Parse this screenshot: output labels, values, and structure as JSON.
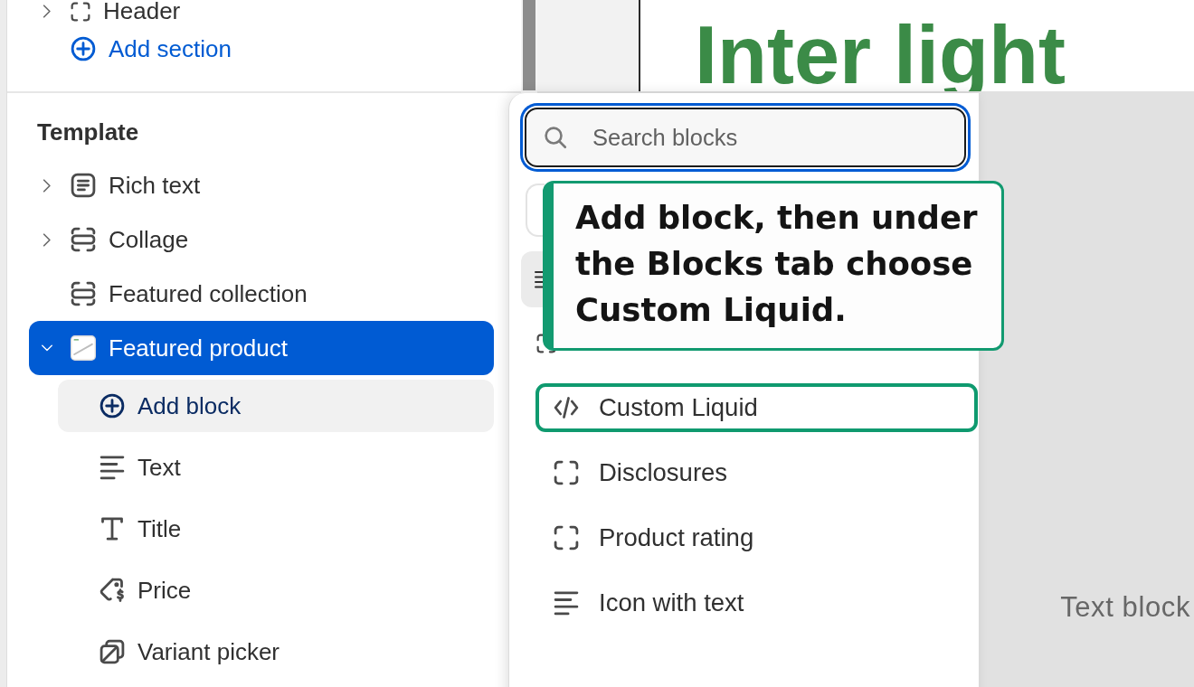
{
  "sidebar": {
    "header_row": {
      "label": "Header",
      "kind": "group",
      "expanded": false
    },
    "add_section": "Add section",
    "template": {
      "title": "Template",
      "sections": [
        {
          "label": "Rich text",
          "kind": "rich-text",
          "expanded": false,
          "selected": false
        },
        {
          "label": "Collage",
          "kind": "collage",
          "expanded": false,
          "selected": false
        },
        {
          "label": "Featured collection",
          "kind": "collection",
          "selected": false
        },
        {
          "label": "Featured product",
          "kind": "product",
          "expanded": true,
          "selected": true,
          "children": [
            {
              "label": "Add block",
              "kind": "add",
              "selected": true
            },
            {
              "label": "Text",
              "kind": "text",
              "selected": false
            },
            {
              "label": "Title",
              "kind": "title",
              "selected": false
            },
            {
              "label": "Price",
              "kind": "price",
              "selected": false
            },
            {
              "label": "Variant picker",
              "kind": "variant",
              "selected": false
            }
          ]
        }
      ]
    }
  },
  "block_picker": {
    "search": {
      "placeholder": "Search blocks",
      "focused": true
    },
    "blocks": [
      {
        "label": "Custom Liquid",
        "kind": "code",
        "highlighted": true
      },
      {
        "label": "Disclosures",
        "kind": "placeholder",
        "highlighted": false
      },
      {
        "label": "Product rating",
        "kind": "placeholder",
        "highlighted": false
      },
      {
        "label": "Icon with text",
        "kind": "lines",
        "highlighted": false
      }
    ]
  },
  "callout": {
    "text": "Add block, then under the Blocks tab choose Custom Liquid."
  },
  "preview": {
    "heading": "Inter light",
    "text_block": "Text block"
  }
}
